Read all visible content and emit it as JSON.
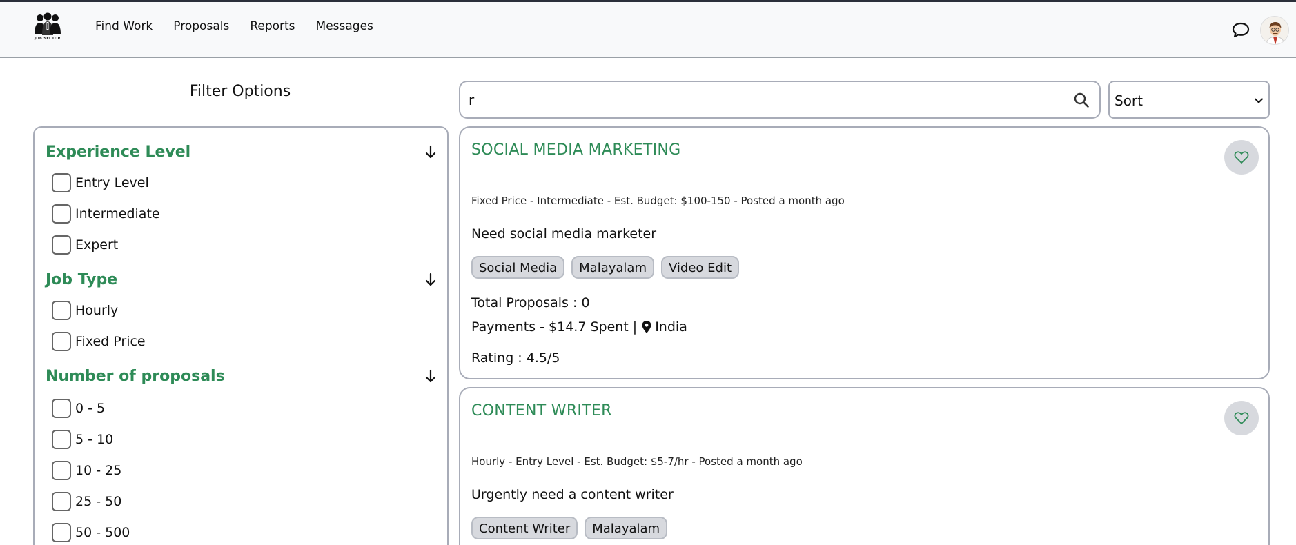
{
  "header": {
    "logo_text": "JOB SECTOR",
    "nav": [
      "Find Work",
      "Proposals",
      "Reports",
      "Messages"
    ],
    "icons": {
      "chat": "chat-bubble-icon",
      "avatar": "user-avatar"
    }
  },
  "filters": {
    "title": "Filter Options",
    "sections": [
      {
        "title": "Experience Level",
        "options": [
          "Entry Level",
          "Intermediate",
          "Expert"
        ]
      },
      {
        "title": "Job Type",
        "options": [
          "Hourly",
          "Fixed Price"
        ]
      },
      {
        "title": "Number of proposals",
        "options": [
          "0 - 5",
          "5 - 10",
          "10 - 25",
          "25 - 50",
          "50 - 500"
        ]
      }
    ]
  },
  "search": {
    "value": "r",
    "icon": "search-icon"
  },
  "sort": {
    "selected": "Sort"
  },
  "jobs": [
    {
      "title": "SOCIAL MEDIA MARKETING",
      "meta": "Fixed Price - Intermediate - Est. Budget: $100-150 - Posted a month ago",
      "description": "Need social media marketer",
      "tags": [
        "Social Media",
        "Malayalam",
        "Video Edit"
      ],
      "proposals": "Total Proposals : 0",
      "payments": "Payments - $14.7 Spent |",
      "location": "India",
      "rating": "Rating : 4.5/5"
    },
    {
      "title": "CONTENT WRITER",
      "meta": "Hourly - Entry Level - Est. Budget: $5-7/hr - Posted a month ago",
      "description": "Urgently need a content writer",
      "tags": [
        "Content Writer",
        "Malayalam"
      ]
    }
  ],
  "colors": {
    "accent_green": "#2e8b57",
    "border": "#a8acb8",
    "tag_bg": "#d7d9de",
    "navbar_bg": "#f8f9fa"
  }
}
